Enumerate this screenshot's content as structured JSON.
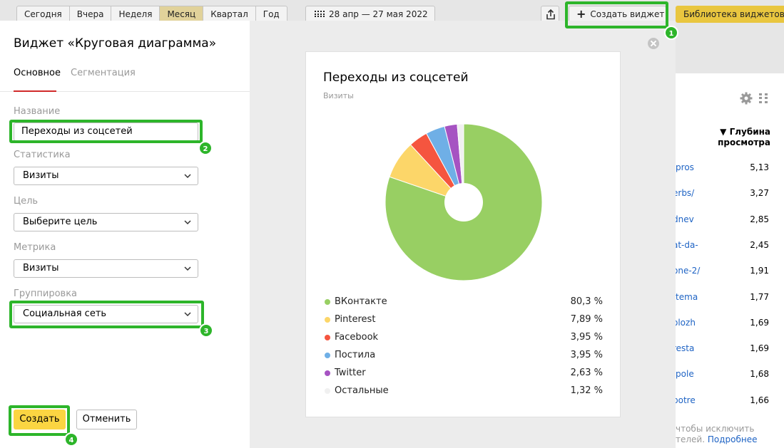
{
  "toolbar": {
    "periods": [
      "Сегодня",
      "Вчера",
      "Неделя",
      "Месяц",
      "Квартал",
      "Год"
    ],
    "active_period": "Месяц",
    "date_range": "28 апр — 27 мая 2022",
    "create_widget_label": "Создать виджет",
    "library_label": "Библиотека виджетов"
  },
  "annotations": [
    "1",
    "2",
    "3",
    "4"
  ],
  "panel": {
    "title": "Виджет «Круговая диаграмма»",
    "tabs": [
      "Основное",
      "Сегментация"
    ],
    "fields": {
      "name_label": "Название",
      "name_value": "Переходы из соцсетей",
      "stat_label": "Статистика",
      "stat_value": "Визиты",
      "goal_label": "Цель",
      "goal_value": "Выберите цель",
      "metric_label": "Метрика",
      "metric_value": "Визиты",
      "group_label": "Группировка",
      "group_value": "Социальная сеть"
    },
    "submit_label": "Создать",
    "cancel_label": "Отменить"
  },
  "preview": {
    "title": "Переходы из соцсетей",
    "subtitle": "Визиты"
  },
  "chart_data": {
    "type": "pie",
    "title": "Переходы из соцсетей",
    "subtitle": "Визиты",
    "donut": true,
    "categories": [
      "ВКонтакте",
      "Pinterest",
      "Facebook",
      "Постила",
      "Twitter",
      "Остальные"
    ],
    "values": [
      80.3,
      7.89,
      3.95,
      3.95,
      2.63,
      1.32
    ],
    "value_labels": [
      "80,3 %",
      "7,89 %",
      "3,95 %",
      "3,95 %",
      "2,63 %",
      "1,32 %"
    ],
    "colors": [
      "#98cf63",
      "#fcd669",
      "#f5553f",
      "#6fafe6",
      "#a653c2",
      "#f0f0f0"
    ],
    "legend": "bottom"
  },
  "right_table": {
    "column_header": "▼ Глубина просмотра",
    "rows": [
      {
        "link": "/pros",
        "value": "5,13"
      },
      {
        "link": "erbs/",
        "value": "3,27"
      },
      {
        "link": "dnev",
        "value": "2,85"
      },
      {
        "link": "at-da-",
        "value": "2,45"
      },
      {
        "link": "one-2/",
        "value": "1,91"
      },
      {
        "link": "/tema",
        "value": "1,77"
      },
      {
        "link": "olozh",
        "value": "1,69"
      },
      {
        "link": "resta",
        "value": "1,69"
      },
      {
        "link": "/pole",
        "value": "1,68"
      },
      {
        "link": "potre",
        "value": "1,66"
      }
    ],
    "footnote_line1": "чтобы исключить",
    "footnote_line2": "телей.",
    "footnote_more": "Подробнее"
  }
}
